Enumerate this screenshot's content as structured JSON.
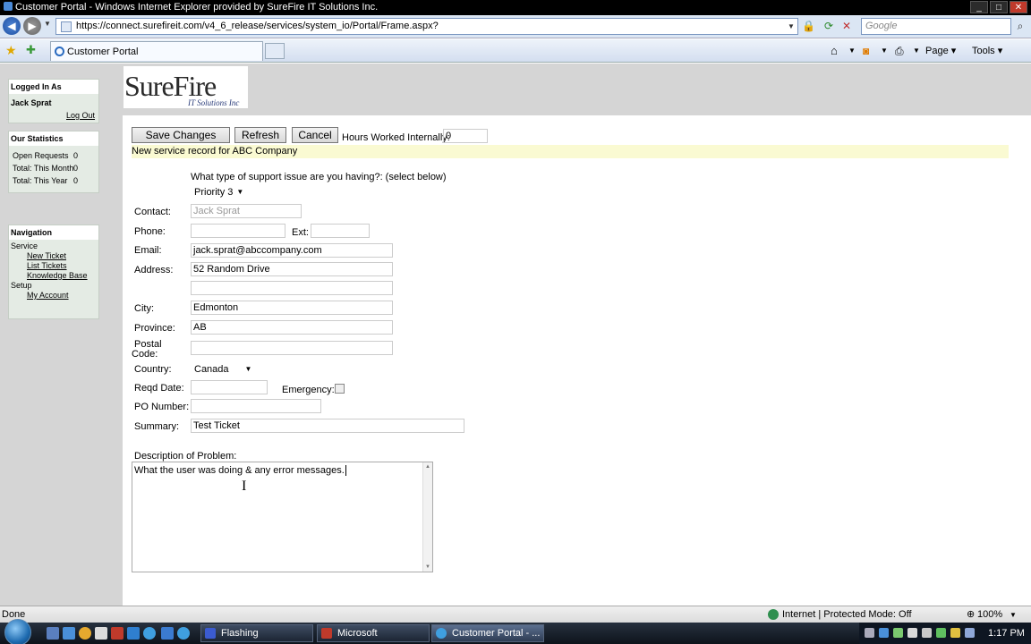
{
  "browser": {
    "window_title": "Customer Portal - Windows Internet Explorer provided by SureFire IT Solutions Inc.",
    "url": "https://connect.surefireit.com/v4_6_release/services/system_io/Portal/Frame.aspx?",
    "search_placeholder": "Google",
    "tab_title": "Customer Portal",
    "commands": {
      "page": "Page",
      "tools": "Tools"
    },
    "status_left": "Done",
    "status_zone": "Internet | Protected Mode: Off",
    "zoom": "100%"
  },
  "sidebar": {
    "logged_in": {
      "title": "Logged In As",
      "user": "Jack Sprat",
      "logout": "Log Out"
    },
    "stats": {
      "title": "Our Statistics",
      "rows": [
        {
          "label": "Open Requests",
          "value": "0"
        },
        {
          "label": "Total: This Month",
          "value": "0"
        },
        {
          "label": "Total: This Year",
          "value": "0"
        }
      ]
    },
    "nav": {
      "title": "Navigation",
      "service": "Service",
      "new_ticket": "New Ticket",
      "list_tickets": "List Tickets",
      "knowledge_base": "Knowledge Base",
      "setup": "Setup",
      "my_account": "My Account"
    }
  },
  "logo": {
    "main": "SureFire",
    "sub": "IT Solutions Inc"
  },
  "toolbar": {
    "save": "Save Changes",
    "refresh": "Refresh",
    "cancel": "Cancel",
    "hours_label": "Hours Worked Internally:",
    "hours_value": "0"
  },
  "notice": "New service record for ABC Company",
  "form": {
    "issue_question": "What type of support issue are you having?: (select below)",
    "priority": "Priority 3",
    "contact_label": "Contact:",
    "contact_value": "Jack Sprat",
    "phone_label": "Phone:",
    "phone_value": "",
    "ext_label": "Ext:",
    "ext_value": "",
    "email_label": "Email:",
    "email_value": "jack.sprat@abccompany.com",
    "address_label": "Address:",
    "address_value": "52 Random Drive",
    "address2_value": "",
    "city_label": "City:",
    "city_value": "Edmonton",
    "province_label": "Province:",
    "province_value": "AB",
    "postal_label_1": "Postal",
    "postal_label_2": "Code:",
    "postal_value": "",
    "country_label": "Country:",
    "country_value": "Canada",
    "reqd_label": "Reqd Date:",
    "reqd_value": "",
    "emergency_label": "Emergency:",
    "po_label": "PO Number:",
    "po_value": "",
    "summary_label": "Summary:",
    "summary_value": "Test Ticket",
    "description_label": "Description of Problem:",
    "description_value": "What the user was doing & any error messages."
  },
  "taskbar": {
    "tasks": [
      "Flashing",
      "Microsoft PowerPoi...",
      "Customer Portal - ..."
    ],
    "clock": "1:17 PM"
  }
}
